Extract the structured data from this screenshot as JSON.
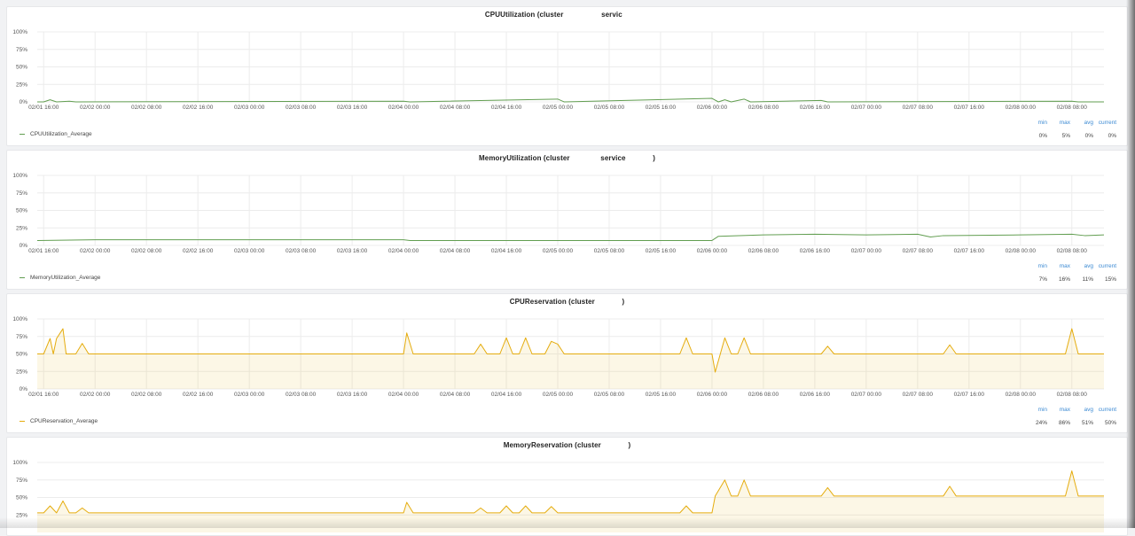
{
  "panels": [
    {
      "title_parts": [
        "CPUUtilization (cluster",
        "servic"
      ],
      "legend": {
        "label": "CPUUtilization_Average",
        "color": "#629e51"
      },
      "stats": {
        "min": "0%",
        "max": "5%",
        "avg": "0%",
        "current": "0%"
      }
    },
    {
      "title_parts": [
        "MemoryUtilization (cluster",
        "service",
        ")"
      ],
      "legend": {
        "label": "MemoryUtilization_Average",
        "color": "#629e51"
      },
      "stats": {
        "min": "7%",
        "max": "16%",
        "avg": "11%",
        "current": "15%"
      }
    },
    {
      "title_parts": [
        "CPUReservation (cluster",
        ")"
      ],
      "legend": {
        "label": "CPUReservation_Average",
        "color": "#e5ac0e"
      },
      "stats": {
        "min": "24%",
        "max": "86%",
        "avg": "51%",
        "current": "50%"
      }
    },
    {
      "title_parts": [
        "MemoryReservation (cluster",
        ")"
      ],
      "legend": {
        "label": "",
        "color": "#e5ac0e"
      },
      "stats": {
        "min": "",
        "max": "",
        "avg": "",
        "current": ""
      }
    }
  ],
  "stat_headers": {
    "min": "min",
    "max": "max",
    "avg": "avg",
    "current": "current"
  },
  "chart_data": [
    {
      "type": "line",
      "title": "CPUUtilization (cluster servic",
      "y_ticks": [
        "0%",
        "25%",
        "50%",
        "75%",
        "100%"
      ],
      "ylim": [
        0,
        100
      ],
      "x_ticks": [
        "02/01 16:00",
        "02/02 00:00",
        "02/02 08:00",
        "02/02 16:00",
        "02/03 00:00",
        "02/03 08:00",
        "02/03 16:00",
        "02/04 00:00",
        "02/04 08:00",
        "02/04 16:00",
        "02/05 00:00",
        "02/05 08:00",
        "02/05 16:00",
        "02/06 00:00",
        "02/06 08:00",
        "02/06 16:00",
        "02/07 00:00",
        "02/07 08:00",
        "02/07 16:00",
        "02/08 00:00",
        "02/08 08:00"
      ],
      "xlim": [
        "02/01 15:00",
        "02/08 13:00"
      ],
      "fill": false,
      "series": [
        {
          "name": "CPUUtilization_Average",
          "color": "#629e51",
          "points": [
            [
              "02/01 15:00",
              0
            ],
            [
              "02/01 16:00",
              0
            ],
            [
              "02/01 17:00",
              3
            ],
            [
              "02/01 18:00",
              0
            ],
            [
              "02/01 20:00",
              1
            ],
            [
              "02/01 21:00",
              0
            ],
            [
              "02/04 00:00",
              1
            ],
            [
              "02/04 01:00",
              0
            ],
            [
              "02/05 00:00",
              4
            ],
            [
              "02/05 01:00",
              0
            ],
            [
              "02/06 00:00",
              5
            ],
            [
              "02/06 01:00",
              0
            ],
            [
              "02/06 02:00",
              3
            ],
            [
              "02/06 03:00",
              0
            ],
            [
              "02/06 05:00",
              4
            ],
            [
              "02/06 06:00",
              0
            ],
            [
              "02/06 17:00",
              2
            ],
            [
              "02/06 18:00",
              0
            ],
            [
              "02/08 08:00",
              1
            ],
            [
              "02/08 09:00",
              0
            ],
            [
              "02/08 13:00",
              0
            ]
          ]
        }
      ]
    },
    {
      "type": "line",
      "title": "MemoryUtilization (cluster service )",
      "y_ticks": [
        "0%",
        "25%",
        "50%",
        "75%",
        "100%"
      ],
      "ylim": [
        0,
        100
      ],
      "x_ticks": [
        "02/01 16:00",
        "02/02 00:00",
        "02/02 08:00",
        "02/02 16:00",
        "02/03 00:00",
        "02/03 08:00",
        "02/03 16:00",
        "02/04 00:00",
        "02/04 08:00",
        "02/04 16:00",
        "02/05 00:00",
        "02/05 08:00",
        "02/05 16:00",
        "02/06 00:00",
        "02/06 08:00",
        "02/06 16:00",
        "02/07 00:00",
        "02/07 08:00",
        "02/07 16:00",
        "02/08 00:00",
        "02/08 08:00"
      ],
      "xlim": [
        "02/01 15:00",
        "02/08 13:00"
      ],
      "fill": false,
      "series": [
        {
          "name": "MemoryUtilization_Average",
          "color": "#629e51",
          "points": [
            [
              "02/01 15:00",
              7
            ],
            [
              "02/02 00:00",
              8
            ],
            [
              "02/03 00:00",
              8
            ],
            [
              "02/04 00:00",
              8
            ],
            [
              "02/04 01:00",
              7
            ],
            [
              "02/05 00:00",
              7
            ],
            [
              "02/05 12:00",
              7
            ],
            [
              "02/06 00:00",
              7
            ],
            [
              "02/06 01:00",
              13
            ],
            [
              "02/06 08:00",
              15
            ],
            [
              "02/06 16:00",
              16
            ],
            [
              "02/07 00:00",
              15
            ],
            [
              "02/07 08:00",
              16
            ],
            [
              "02/07 10:00",
              12
            ],
            [
              "02/07 12:00",
              14
            ],
            [
              "02/08 00:00",
              15
            ],
            [
              "02/08 08:00",
              16
            ],
            [
              "02/08 10:00",
              14
            ],
            [
              "02/08 13:00",
              15
            ]
          ]
        }
      ]
    },
    {
      "type": "area",
      "title": "CPUReservation (cluster )",
      "y_ticks": [
        "0%",
        "25%",
        "50%",
        "75%",
        "100%"
      ],
      "ylim": [
        0,
        100
      ],
      "x_ticks": [
        "02/01 16:00",
        "02/02 00:00",
        "02/02 08:00",
        "02/02 16:00",
        "02/03 00:00",
        "02/03 08:00",
        "02/03 16:00",
        "02/04 00:00",
        "02/04 08:00",
        "02/04 16:00",
        "02/05 00:00",
        "02/05 08:00",
        "02/05 16:00",
        "02/06 00:00",
        "02/06 08:00",
        "02/06 16:00",
        "02/07 00:00",
        "02/07 08:00",
        "02/07 16:00",
        "02/08 00:00",
        "02/08 08:00"
      ],
      "xlim": [
        "02/01 15:00",
        "02/08 13:00"
      ],
      "fill": true,
      "series": [
        {
          "name": "CPUReservation_Average",
          "color": "#e5ac0e",
          "points": [
            [
              "02/01 15:00",
              50
            ],
            [
              "02/01 16:00",
              50
            ],
            [
              "02/01 17:00",
              72
            ],
            [
              "02/01 17:30",
              50
            ],
            [
              "02/01 18:00",
              72
            ],
            [
              "02/01 19:00",
              86
            ],
            [
              "02/01 19:30",
              50
            ],
            [
              "02/01 21:00",
              50
            ],
            [
              "02/01 22:00",
              65
            ],
            [
              "02/01 23:00",
              50
            ],
            [
              "02/04 00:00",
              50
            ],
            [
              "02/04 00:30",
              80
            ],
            [
              "02/04 01:30",
              50
            ],
            [
              "02/04 11:00",
              50
            ],
            [
              "02/04 12:00",
              64
            ],
            [
              "02/04 13:00",
              50
            ],
            [
              "02/04 15:00",
              50
            ],
            [
              "02/04 16:00",
              73
            ],
            [
              "02/04 17:00",
              50
            ],
            [
              "02/04 18:00",
              50
            ],
            [
              "02/04 19:00",
              73
            ],
            [
              "02/04 20:00",
              50
            ],
            [
              "02/04 22:00",
              50
            ],
            [
              "02/04 23:00",
              68
            ],
            [
              "02/05 00:00",
              64
            ],
            [
              "02/05 01:00",
              50
            ],
            [
              "02/05 19:00",
              50
            ],
            [
              "02/05 20:00",
              73
            ],
            [
              "02/05 21:00",
              50
            ],
            [
              "02/06 00:00",
              50
            ],
            [
              "02/06 00:30",
              24
            ],
            [
              "02/06 02:00",
              73
            ],
            [
              "02/06 03:00",
              50
            ],
            [
              "02/06 04:00",
              50
            ],
            [
              "02/06 05:00",
              73
            ],
            [
              "02/06 06:00",
              50
            ],
            [
              "02/06 17:00",
              50
            ],
            [
              "02/06 18:00",
              61
            ],
            [
              "02/06 19:00",
              50
            ],
            [
              "02/07 12:00",
              50
            ],
            [
              "02/07 13:00",
              63
            ],
            [
              "02/07 14:00",
              50
            ],
            [
              "02/08 07:00",
              50
            ],
            [
              "02/08 08:00",
              86
            ],
            [
              "02/08 09:00",
              50
            ],
            [
              "02/08 13:00",
              50
            ]
          ]
        }
      ]
    },
    {
      "type": "area",
      "title": "MemoryReservation (cluster )",
      "y_ticks": [
        "25%",
        "50%",
        "75%",
        "100%"
      ],
      "ylim": [
        0,
        100
      ],
      "x_ticks": [],
      "xlim": [
        "02/01 15:00",
        "02/08 13:00"
      ],
      "fill": true,
      "series": [
        {
          "name": "",
          "color": "#e5ac0e",
          "points": [
            [
              "02/01 15:00",
              28
            ],
            [
              "02/01 16:00",
              28
            ],
            [
              "02/01 17:00",
              38
            ],
            [
              "02/01 18:00",
              28
            ],
            [
              "02/01 19:00",
              45
            ],
            [
              "02/01 20:00",
              28
            ],
            [
              "02/01 21:00",
              28
            ],
            [
              "02/01 22:00",
              35
            ],
            [
              "02/01 23:00",
              28
            ],
            [
              "02/04 00:00",
              28
            ],
            [
              "02/04 00:30",
              43
            ],
            [
              "02/04 01:30",
              28
            ],
            [
              "02/04 11:00",
              28
            ],
            [
              "02/04 12:00",
              35
            ],
            [
              "02/04 13:00",
              28
            ],
            [
              "02/04 15:00",
              28
            ],
            [
              "02/04 16:00",
              38
            ],
            [
              "02/04 17:00",
              28
            ],
            [
              "02/04 18:00",
              28
            ],
            [
              "02/04 19:00",
              38
            ],
            [
              "02/04 20:00",
              28
            ],
            [
              "02/04 22:00",
              28
            ],
            [
              "02/04 23:00",
              37
            ],
            [
              "02/05 00:00",
              28
            ],
            [
              "02/05 19:00",
              28
            ],
            [
              "02/05 20:00",
              38
            ],
            [
              "02/05 21:00",
              28
            ],
            [
              "02/06 00:00",
              28
            ],
            [
              "02/06 00:30",
              52
            ],
            [
              "02/06 02:00",
              75
            ],
            [
              "02/06 03:00",
              52
            ],
            [
              "02/06 04:00",
              52
            ],
            [
              "02/06 05:00",
              75
            ],
            [
              "02/06 06:00",
              52
            ],
            [
              "02/06 17:00",
              52
            ],
            [
              "02/06 18:00",
              64
            ],
            [
              "02/06 19:00",
              52
            ],
            [
              "02/07 12:00",
              52
            ],
            [
              "02/07 13:00",
              66
            ],
            [
              "02/07 14:00",
              52
            ],
            [
              "02/08 07:00",
              52
            ],
            [
              "02/08 08:00",
              88
            ],
            [
              "02/08 09:00",
              52
            ],
            [
              "02/08 13:00",
              52
            ]
          ]
        }
      ]
    }
  ]
}
